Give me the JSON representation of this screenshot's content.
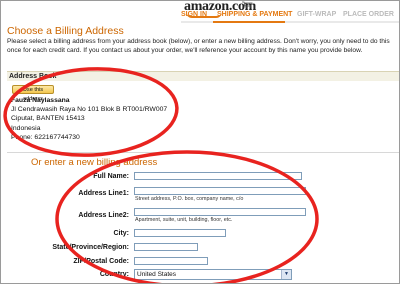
{
  "header": {
    "logo": "amazon.com",
    "steps": [
      "SIGN IN",
      "SHIPPING & PAYMENT",
      "GIFT-WRAP",
      "PLACE ORDER"
    ]
  },
  "page": {
    "title": "Choose a Billing Address",
    "intro": "Please select a billing address from your address book (below), or enter a new billing address.  Don't worry, you only need to do this once for each credit card.  If you contact us about your order, we'll reference your account by this name you provide below."
  },
  "address_book": {
    "heading": "Address Book",
    "use_button": "Use this address",
    "name": "Fauza Naylassana",
    "line1": "Jl Cendrawasih Raya No 101 Blok B RT001/RW007",
    "line2": "Ciputat, BANTEN 15413",
    "country": "Indonesia",
    "phone": "Phone: 622167744730"
  },
  "new_address": {
    "heading": "Or enter a new billing address",
    "full_name_label": "Full Name:",
    "line1_label": "Address Line1:",
    "line1_hint": "Street address, P.O. box, company name, c/o",
    "line2_label": "Address Line2:",
    "line2_hint": "Apartment, suite, unit, building, floor, etc.",
    "city_label": "City:",
    "state_label": "State/Province/Region:",
    "zip_label": "ZIP/Postal Code:",
    "country_label": "Country:",
    "country_value": "United States"
  },
  "colors": {
    "accent": "#cc6600",
    "annotation": "#e8231f",
    "step_active": "#e47911"
  }
}
